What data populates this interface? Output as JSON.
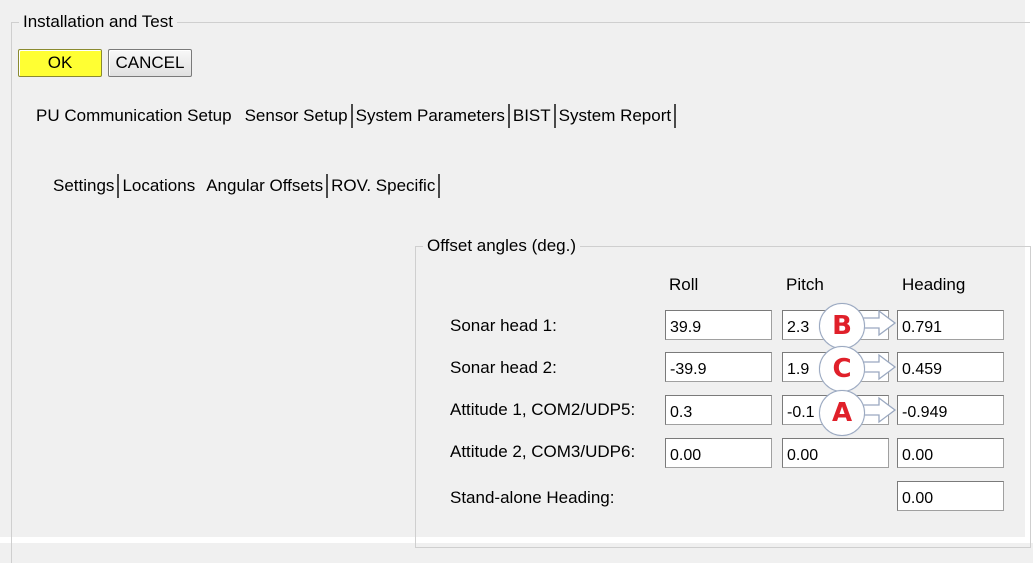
{
  "window": {
    "group_title": "Installation and Test"
  },
  "buttons": {
    "ok_label": "OK",
    "cancel_label": "CANCEL"
  },
  "main_tabs": [
    {
      "label": "PU Communication Setup"
    },
    {
      "label": "Sensor Setup"
    },
    {
      "label": "System Parameters"
    },
    {
      "label": "BIST"
    },
    {
      "label": "System Report"
    }
  ],
  "sub_tabs": [
    {
      "label": "Settings"
    },
    {
      "label": "Locations"
    },
    {
      "label": "Angular Offsets"
    },
    {
      "label": "ROV. Specific"
    }
  ],
  "offsets": {
    "group_title": "Offset angles (deg.)",
    "columns": {
      "roll": "Roll",
      "pitch": "Pitch",
      "heading": "Heading"
    },
    "rows": [
      {
        "label": "Sonar head 1:",
        "roll": "39.9",
        "pitch": "2.3",
        "heading": "0.791"
      },
      {
        "label": "Sonar head 2:",
        "roll": "-39.9",
        "pitch": "1.9",
        "heading": "0.459"
      },
      {
        "label": "Attitude 1, COM2/UDP5:",
        "roll": "0.3",
        "pitch": "-0.1",
        "heading": "-0.949"
      },
      {
        "label": "Attitude 2, COM3/UDP6:",
        "roll": "0.00",
        "pitch": "0.00",
        "heading": "0.00"
      },
      {
        "label": "Stand-alone Heading:",
        "heading": "0.00"
      }
    ]
  },
  "callouts": [
    {
      "letter": "B"
    },
    {
      "letter": "C"
    },
    {
      "letter": "A"
    }
  ],
  "colors": {
    "ok_button": "#ffff33",
    "callout_letter": "#e0202a"
  }
}
